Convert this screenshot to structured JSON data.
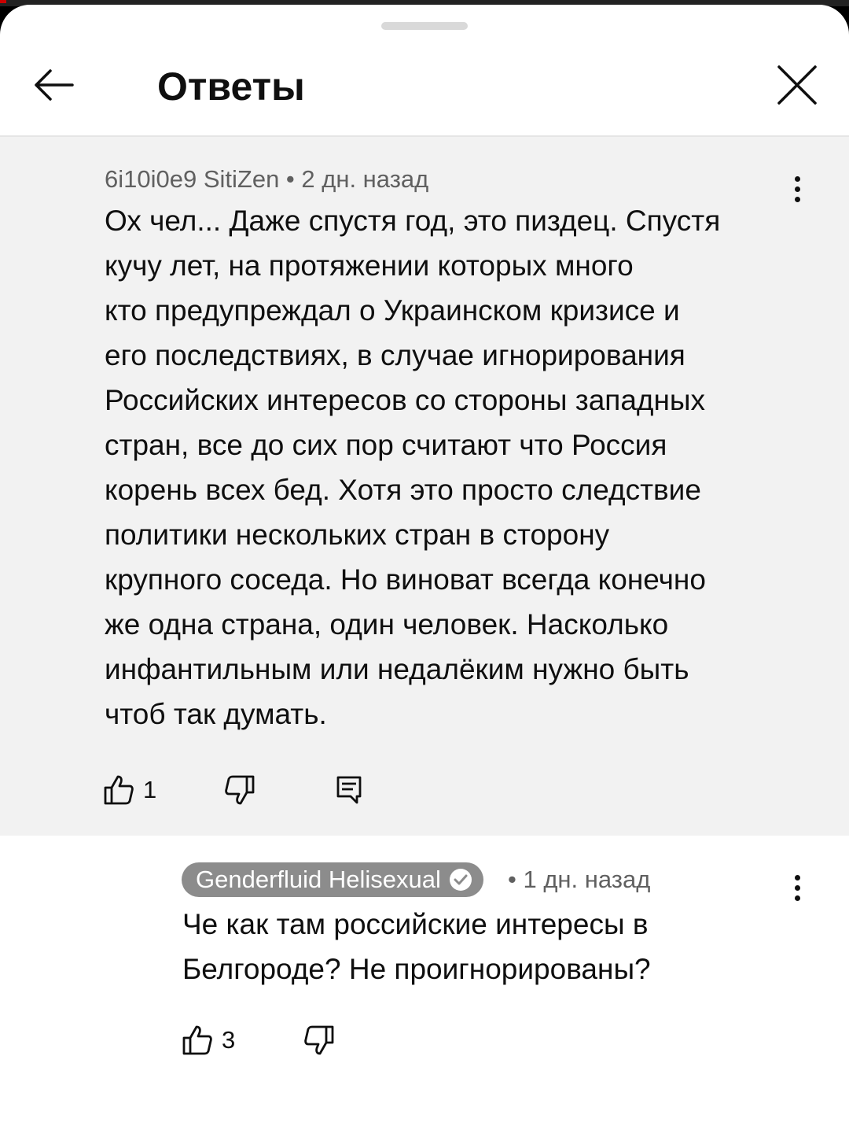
{
  "header": {
    "title": "Ответы"
  },
  "parent_comment": {
    "meta": "6i10i0e9 SitiZen • 2 дн. назад",
    "lines": [
      "Ох чел... Даже спустя год, это пиздец. Спустя",
      "кучу лет, на протяжении которых много",
      "кто предупреждал о Украинском кризисе и",
      "его последствиях, в случае игнорирования",
      "Российских интересов со стороны западных",
      "стран, все до сих пор считают что Россия",
      "корень всех бед. Хотя это просто следствие",
      "политики нескольких стран в сторону",
      "крупного соседа. Но виноват всегда конечно",
      "же одна страна, один человек. Насколько",
      "инфантильным или недалёким нужно быть",
      "чтоб так думать."
    ],
    "likes": "1",
    "icons": {
      "like": "thumbs-up-icon",
      "dislike": "thumbs-down-icon",
      "reply": "reply-comment-icon",
      "more": "more-vertical-icon"
    }
  },
  "reply_comment": {
    "author": "Genderfluid Helisexual",
    "time": "• 1 дн. назад",
    "lines": [
      "Че как там российские интересы в",
      "Белгороде? Не проигнорированы?"
    ],
    "likes": "3",
    "verified_icon": "verified-check-icon"
  },
  "colors": {
    "sheet": "#ffffff",
    "highlight": "#f2f2f2",
    "secondary_text": "#606060",
    "chip": "#8c8c8c"
  }
}
